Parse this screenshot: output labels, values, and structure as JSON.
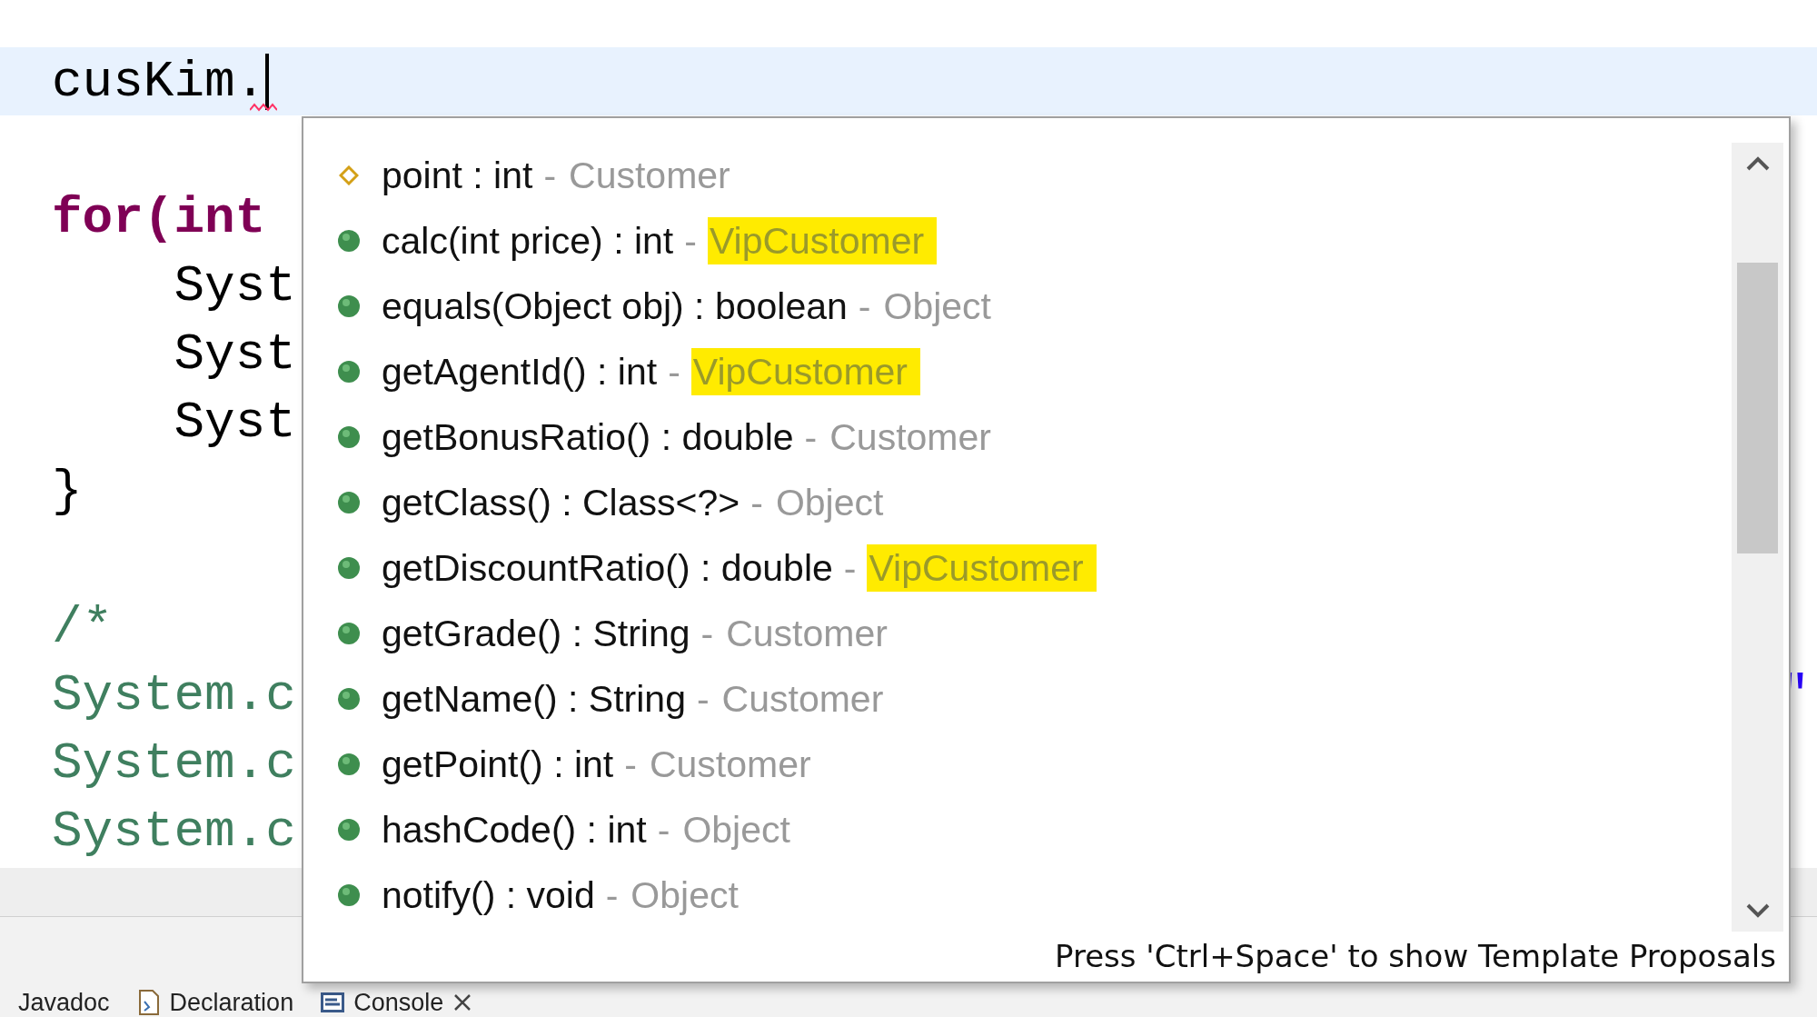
{
  "editor": {
    "lines": [
      {
        "kind": "code",
        "current": true,
        "error": true,
        "segments": [
          {
            "text": "cusKim.",
            "kind": "plain"
          }
        ]
      },
      {
        "kind": "blank"
      },
      {
        "kind": "code",
        "current": false,
        "segments": [
          {
            "text": "for",
            "kind": "keyword"
          },
          {
            "text": "(",
            "kind": "keyword"
          },
          {
            "text": "int",
            "kind": "keyword"
          }
        ]
      },
      {
        "kind": "code",
        "current": false,
        "segments": [
          {
            "text": "    Syst",
            "kind": "plain"
          }
        ]
      },
      {
        "kind": "code",
        "current": false,
        "segments": [
          {
            "text": "    Syst",
            "kind": "plain"
          }
        ]
      },
      {
        "kind": "code",
        "current": false,
        "segments": [
          {
            "text": "    Syst",
            "kind": "plain"
          }
        ]
      },
      {
        "kind": "code",
        "current": false,
        "segments": [
          {
            "text": "}",
            "kind": "plain"
          }
        ]
      },
      {
        "kind": "blank"
      },
      {
        "kind": "code",
        "current": false,
        "segments": [
          {
            "text": "/*",
            "kind": "comment"
          }
        ]
      },
      {
        "kind": "code",
        "current": false,
        "segments": [
          {
            "text": "System.c",
            "kind": "comment"
          }
        ],
        "tail": "\""
      },
      {
        "kind": "code",
        "current": false,
        "segments": [
          {
            "text": "System.c",
            "kind": "comment"
          }
        ]
      },
      {
        "kind": "code",
        "current": false,
        "segments": [
          {
            "text": "System.c",
            "kind": "comment"
          }
        ]
      }
    ]
  },
  "proposals": {
    "items": [
      {
        "kind": "field",
        "signature": "point : int",
        "separator": "-",
        "owner": "Customer",
        "highlighted": false
      },
      {
        "kind": "method",
        "signature": "calc(int price) : int",
        "separator": "-",
        "owner": "VipCustomer",
        "highlighted": true
      },
      {
        "kind": "method",
        "signature": "equals(Object obj) : boolean",
        "separator": "-",
        "owner": "Object",
        "highlighted": false
      },
      {
        "kind": "method",
        "signature": "getAgentId() : int",
        "separator": "-",
        "owner": "VipCustomer",
        "highlighted": true
      },
      {
        "kind": "method",
        "signature": "getBonusRatio() : double",
        "separator": "-",
        "owner": "Customer",
        "highlighted": false
      },
      {
        "kind": "method",
        "signature": "getClass() : Class<?>",
        "separator": "-",
        "owner": "Object",
        "highlighted": false
      },
      {
        "kind": "method",
        "signature": "getDiscountRatio() : double",
        "separator": "-",
        "owner": "VipCustomer",
        "highlighted": true
      },
      {
        "kind": "method",
        "signature": "getGrade() : String",
        "separator": "-",
        "owner": "Customer",
        "highlighted": false
      },
      {
        "kind": "method",
        "signature": "getName() : String",
        "separator": "-",
        "owner": "Customer",
        "highlighted": false
      },
      {
        "kind": "method",
        "signature": "getPoint() : int",
        "separator": "-",
        "owner": "Customer",
        "highlighted": false
      },
      {
        "kind": "method",
        "signature": "hashCode() : int",
        "separator": "-",
        "owner": "Object",
        "highlighted": false
      },
      {
        "kind": "method",
        "signature": "notify() : void",
        "separator": "-",
        "owner": "Object",
        "highlighted": false
      }
    ],
    "footer": "Press 'Ctrl+Space' to show Template Proposals"
  },
  "bottom_tabs": [
    {
      "label": "Javadoc",
      "kind": "plain",
      "closable": false
    },
    {
      "label": "Declaration",
      "kind": "doc",
      "closable": false
    },
    {
      "label": "Console",
      "kind": "console",
      "closable": true
    }
  ]
}
